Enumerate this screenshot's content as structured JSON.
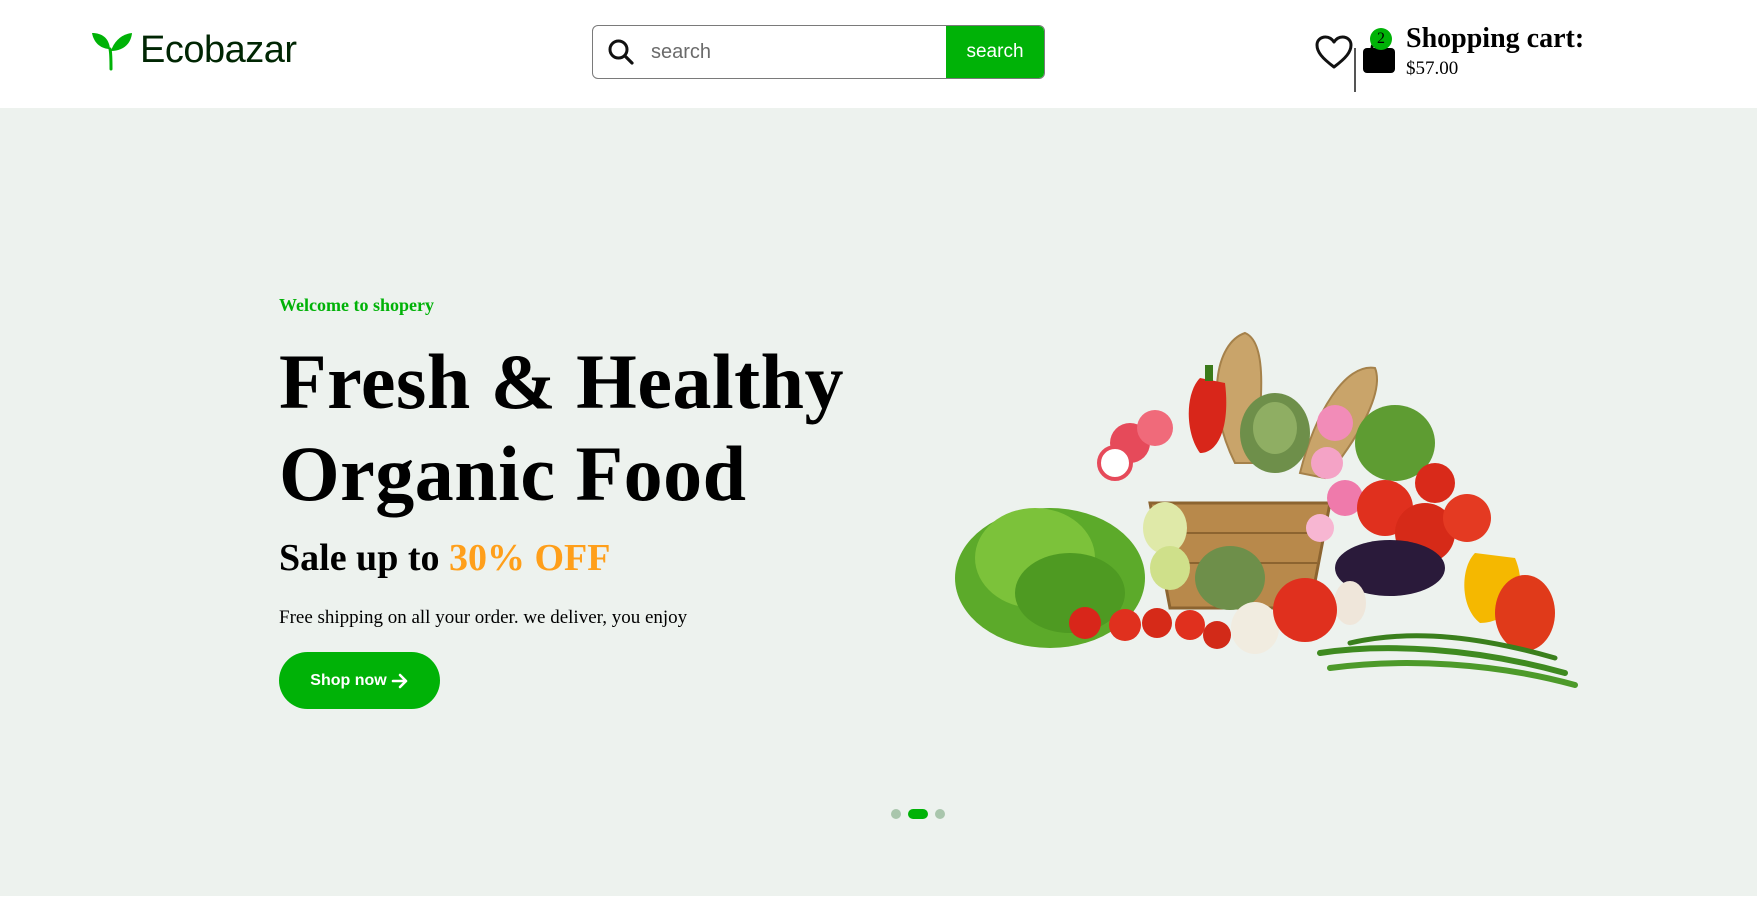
{
  "header": {
    "logo_text": "Ecobazar",
    "search": {
      "placeholder": "search",
      "value": "",
      "button_label": "search"
    },
    "cart": {
      "label": "Shopping cart:",
      "total": "$57.00",
      "count": "2"
    }
  },
  "hero": {
    "welcome": "Welcome to shopery",
    "headline_line1": "Fresh & Healthy",
    "headline_line2": "Organic Food",
    "sale_prefix": "Sale up to ",
    "sale_highlight": "30% OFF",
    "subtext": "Free shipping on all your order. we deliver, you enjoy",
    "cta_label": "Shop now"
  },
  "slider": {
    "slide_count": 3,
    "active_index": 1
  },
  "colors": {
    "brand_green": "#00b207",
    "accent_orange": "#ff9f1a",
    "hero_bg": "#edf2ee"
  }
}
